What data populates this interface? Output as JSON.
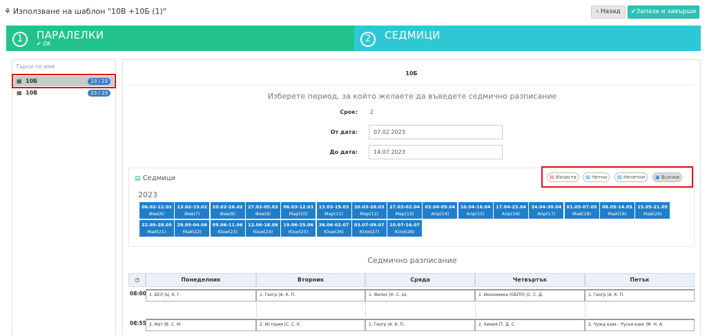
{
  "header": {
    "icon": "template-icon",
    "title": "Използване на шаблон \"10В +10Б (1)\"",
    "back_label": "‹ Назад",
    "save_label": "✔Запази и завърши"
  },
  "steps": [
    {
      "num": "1",
      "title": "ПАРАЛЕЛКИ",
      "sub": "✔ OK",
      "color": "#22c38a"
    },
    {
      "num": "2",
      "title": "СЕДМИЦИ",
      "sub": "",
      "color": "#2ec8d4"
    }
  ],
  "sidebar": {
    "search_placeholder": "Търси по име",
    "items": [
      {
        "icon": "class-icon",
        "name": "10Б",
        "badge": "23 / 23",
        "selected": true
      },
      {
        "icon": "class-icon",
        "name": "10В",
        "badge": "23 / 23",
        "selected": false
      }
    ]
  },
  "main": {
    "class_name": "10Б",
    "prompt": "Изберете период, за който желаете да въведете седмично разписание",
    "term_label": "Срок:",
    "term_value": "2",
    "from_label": "От дата:",
    "from_value": "07.02.2023",
    "to_label": "До дата:",
    "to_value": "14.07.2023"
  },
  "weeks": {
    "title": "Седмици",
    "buttons": [
      "Изчисти",
      "Четни",
      "Нечетни",
      "Всички"
    ],
    "year": "2023",
    "items": [
      {
        "range": "06.02-12.02",
        "label": "Фев(6)"
      },
      {
        "range": "13.02-19.02",
        "label": "Фев(7)"
      },
      {
        "range": "20.02-26.02",
        "label": "Фев(8)"
      },
      {
        "range": "27.02-05.03",
        "label": "Фев(9)"
      },
      {
        "range": "06.03-12.03",
        "label": "Мар(10)"
      },
      {
        "range": "13.03-19.03",
        "label": "Мар(11)"
      },
      {
        "range": "20.03-26.03",
        "label": "Мар(12)"
      },
      {
        "range": "27.03-02.04",
        "label": "Мар(13)"
      },
      {
        "range": "03.04-09.04",
        "label": "Апр(14)"
      },
      {
        "range": "10.04-16.04",
        "label": "Апр(15)"
      },
      {
        "range": "17.04-23.04",
        "label": "Апр(16)"
      },
      {
        "range": "24.04-30.04",
        "label": "Апр(17)"
      },
      {
        "range": "01.05-07.05",
        "label": "Май(18)"
      },
      {
        "range": "08.05-14.05",
        "label": "Май(19)"
      },
      {
        "range": "15.05-21.05",
        "label": "Май(20)"
      },
      {
        "range": "22.05-28.05",
        "label": "Май(21)"
      },
      {
        "range": "29.05-04.06",
        "label": "Май(22)"
      },
      {
        "range": "05.06-11.06",
        "label": "Юни(23)"
      },
      {
        "range": "12.06-18.06",
        "label": "Юни(24)"
      },
      {
        "range": "19.06-25.06",
        "label": "Юни(25)"
      },
      {
        "range": "26.06-02.07",
        "label": "Юни(26)"
      },
      {
        "range": "03.07-09.07",
        "label": "Юли(27)"
      },
      {
        "range": "10.07-16.07",
        "label": "Юли(28)"
      }
    ]
  },
  "schedule": {
    "title": "Седмично разписание",
    "clock_icon": "clock-icon",
    "days": [
      "Понеделник",
      "Вторник",
      "Сряда",
      "Четвъртък",
      "Петък"
    ],
    "rows": [
      {
        "time": "08:00",
        "cells": [
          "1. БЕЛ |Ц. К. Г.",
          "1. Геогр |А. К. П.",
          "1. Филос |Н. С. Ш.",
          "1. Икономика (ОБПП) |С. С. Д.",
          "1. Геогр |А. К. П."
        ]
      },
      {
        "time": "08:55",
        "cells": [
          "2. Мат |В. С. М.",
          "2. История |С. С. К.",
          "2. Геогр |А. К. П.",
          "2. Химия |Т. Д. С.",
          "2. Чужд език - Руски език |М. Н. А."
        ]
      }
    ]
  }
}
